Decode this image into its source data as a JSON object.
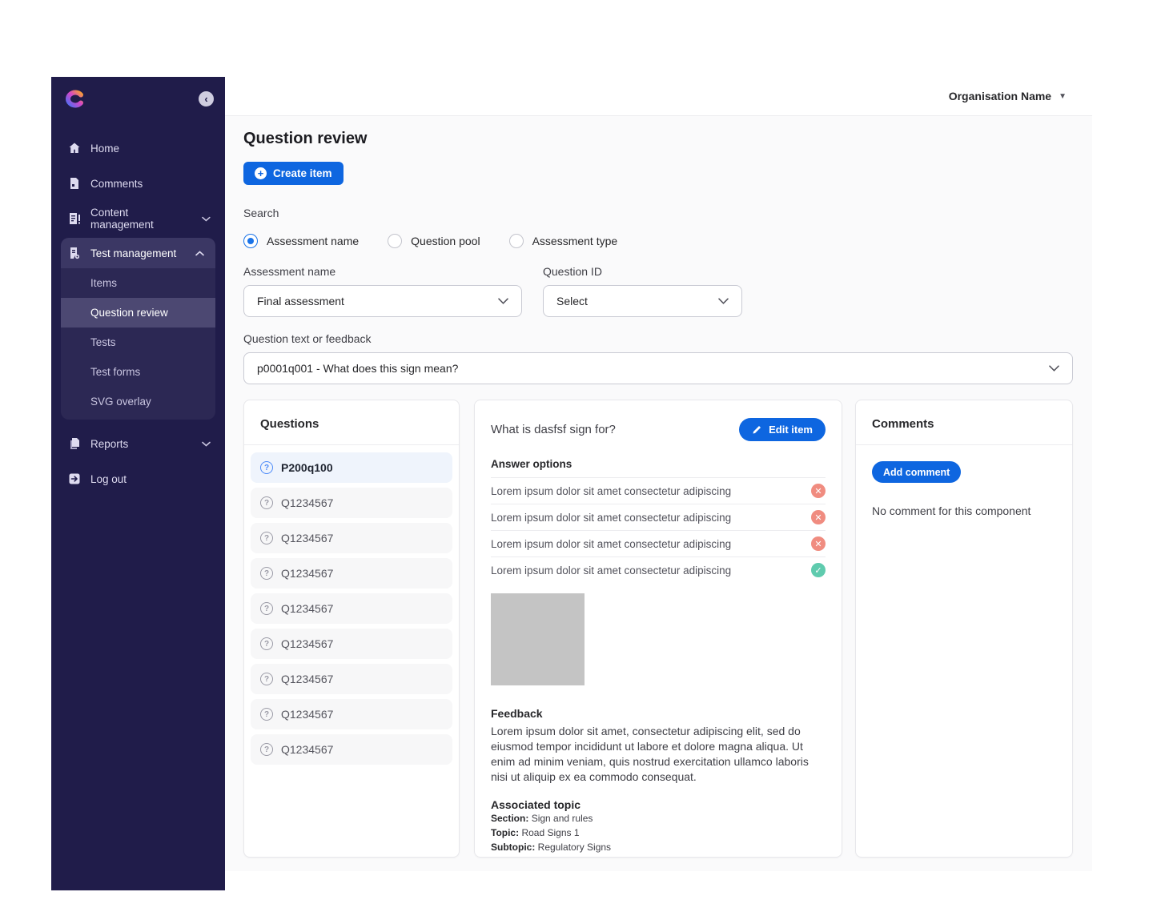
{
  "header": {
    "org_name": "Organisation Name"
  },
  "icons": {
    "question_mark": "?",
    "cross": "✕",
    "check": "✓",
    "caret_down": "▼",
    "chevron_left": "‹",
    "plus": "+"
  },
  "sidebar": {
    "home": "Home",
    "comments": "Comments",
    "content_management": "Content management",
    "test_management": "Test management",
    "submenu": [
      "Items",
      "Question review",
      "Tests",
      "Test forms",
      "SVG overlay"
    ],
    "reports": "Reports",
    "logout": "Log out"
  },
  "colors": {
    "accent_blue": "#0e66e0",
    "incorrect_red": "#f08c80",
    "correct_teal": "#5fcbae",
    "sidebar_bg": "#201c4a"
  },
  "main": {
    "title": "Question review",
    "create_item": "Create item",
    "search_label": "Search",
    "radios": [
      "Assessment name",
      "Question pool",
      "Assessment type"
    ],
    "selected_radio": "Assessment name",
    "assessment_name": {
      "label": "Assessment name",
      "value": "Final assessment"
    },
    "question_id": {
      "label": "Question ID",
      "value": "Select"
    },
    "question_text": {
      "label": "Question text or feedback",
      "value": "p0001q001 - What does this sign mean?"
    }
  },
  "questions_panel": {
    "title": "Questions",
    "items": [
      {
        "id": "P200q100",
        "selected": true
      },
      {
        "id": "Q1234567"
      },
      {
        "id": "Q1234567"
      },
      {
        "id": "Q1234567"
      },
      {
        "id": "Q1234567"
      },
      {
        "id": "Q1234567"
      },
      {
        "id": "Q1234567"
      },
      {
        "id": "Q1234567"
      },
      {
        "id": "Q1234567"
      }
    ]
  },
  "detail_panel": {
    "title": "What is dasfsf sign for?",
    "edit_item": "Edit item",
    "answer_options_label": "Answer options",
    "options": [
      {
        "text": "Lorem ipsum dolor sit amet consectetur adipiscing",
        "correct": false
      },
      {
        "text": "Lorem ipsum dolor sit amet consectetur adipiscing",
        "correct": false
      },
      {
        "text": "Lorem ipsum dolor sit amet consectetur adipiscing",
        "correct": false
      },
      {
        "text": "Lorem ipsum dolor sit amet consectetur adipiscing",
        "correct": true
      }
    ],
    "feedback_label": "Feedback",
    "feedback_text": "Lorem ipsum dolor sit amet, consectetur adipiscing elit, sed do eiusmod tempor incididunt ut labore et dolore magna aliqua. Ut enim ad minim veniam, quis nostrud exercitation ullamco laboris nisi ut aliquip ex ea commodo consequat.",
    "associated_topic_label": "Associated topic",
    "section_label": "Section:",
    "section_value": "Sign and rules",
    "topic_label": "Topic:",
    "topic_value": "Road Signs 1",
    "subtopic_label": "Subtopic:",
    "subtopic_value": "Regulatory Signs"
  },
  "comments_panel": {
    "title": "Comments",
    "add_comment": "Add comment",
    "empty_text": "No comment for this component"
  }
}
